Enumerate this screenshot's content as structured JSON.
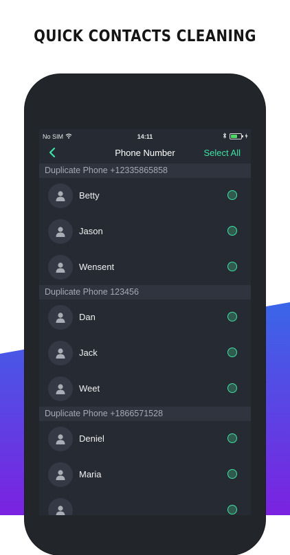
{
  "headline": "QUICK CONTACTS CLEANING",
  "colors": {
    "accent": "#3fe3a4",
    "gradient_start": "#3a66e8",
    "gradient_end": "#7b22e0",
    "phone_frame": "#222529",
    "screen_bg": "#262a33"
  },
  "status_bar": {
    "carrier": "No SIM",
    "time": "14:11",
    "icons": [
      "wifi-icon",
      "bluetooth-icon",
      "battery-icon",
      "charging-icon"
    ],
    "battery_level": 0.65
  },
  "nav": {
    "back_icon": "chevron-left-icon",
    "title": "Phone Number",
    "select_all_label": "Select All"
  },
  "groups": [
    {
      "header": "Duplicate Phone +12335865858",
      "contacts": [
        {
          "name": "Betty",
          "selected": false
        },
        {
          "name": "Jason",
          "selected": false
        },
        {
          "name": "Wensent",
          "selected": false
        }
      ]
    },
    {
      "header": "Duplicate Phone 123456",
      "contacts": [
        {
          "name": "Dan",
          "selected": false
        },
        {
          "name": "Jack",
          "selected": false
        },
        {
          "name": "Weet",
          "selected": false
        }
      ]
    },
    {
      "header": "Duplicate Phone +1866571528",
      "contacts": [
        {
          "name": "Deniel",
          "selected": false
        },
        {
          "name": "Maria",
          "selected": false
        },
        {
          "name": "",
          "selected": false
        }
      ]
    }
  ]
}
